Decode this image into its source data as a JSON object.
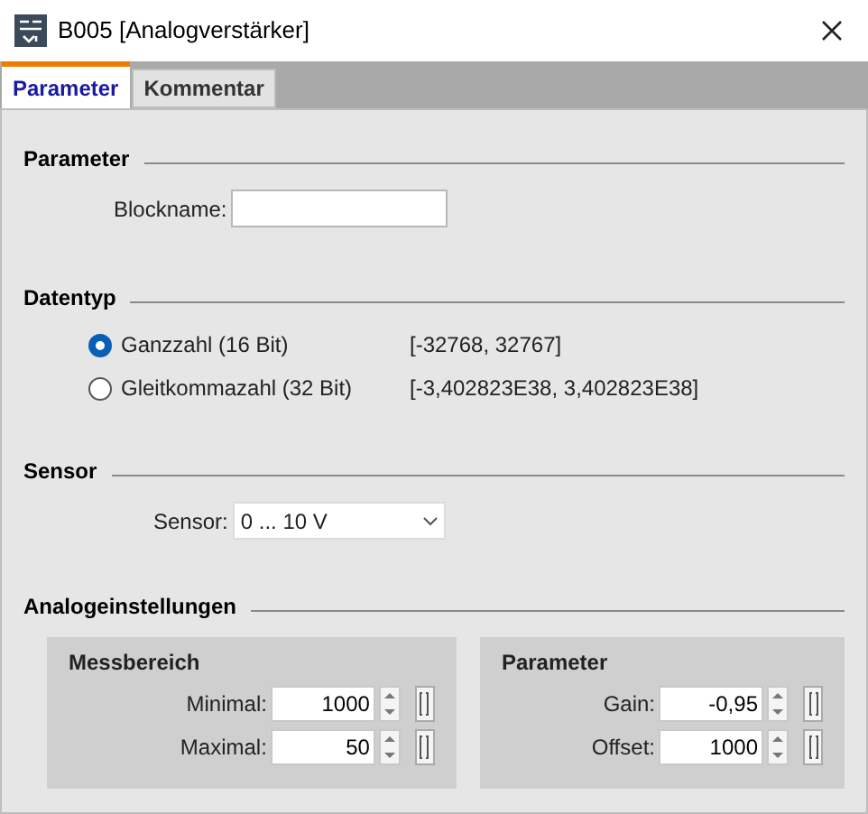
{
  "window": {
    "title": "B005 [Analogverstärker]"
  },
  "tabs": [
    {
      "label": "Parameter",
      "selected": true
    },
    {
      "label": "Kommentar",
      "selected": false
    }
  ],
  "parameter": {
    "heading": "Parameter",
    "blockname": {
      "label": "Blockname:"
    }
  },
  "datentyp": {
    "heading": "Datentyp",
    "options": [
      {
        "label": "Ganzzahl (16 Bit)",
        "range": "[-32768, 32767]",
        "selected": true
      },
      {
        "label": "Gleitkommazahl (32 Bit)",
        "range": "[-3,402823E38, 3,402823E38]",
        "selected": false
      }
    ]
  },
  "sensor": {
    "heading": "Sensor",
    "label": "Sensor:",
    "value": "0 ... 10 V"
  },
  "analog": {
    "heading": "Analogeinstellungen",
    "groups": [
      {
        "title": "Messbereich",
        "fields": [
          {
            "label": "Minimal:",
            "value": "1000"
          },
          {
            "label": "Maximal:",
            "value": "50"
          }
        ]
      },
      {
        "title": "Parameter",
        "fields": [
          {
            "label": "Gain:",
            "value": "-0,95"
          },
          {
            "label": "Offset:",
            "value": "1000"
          }
        ]
      }
    ]
  }
}
